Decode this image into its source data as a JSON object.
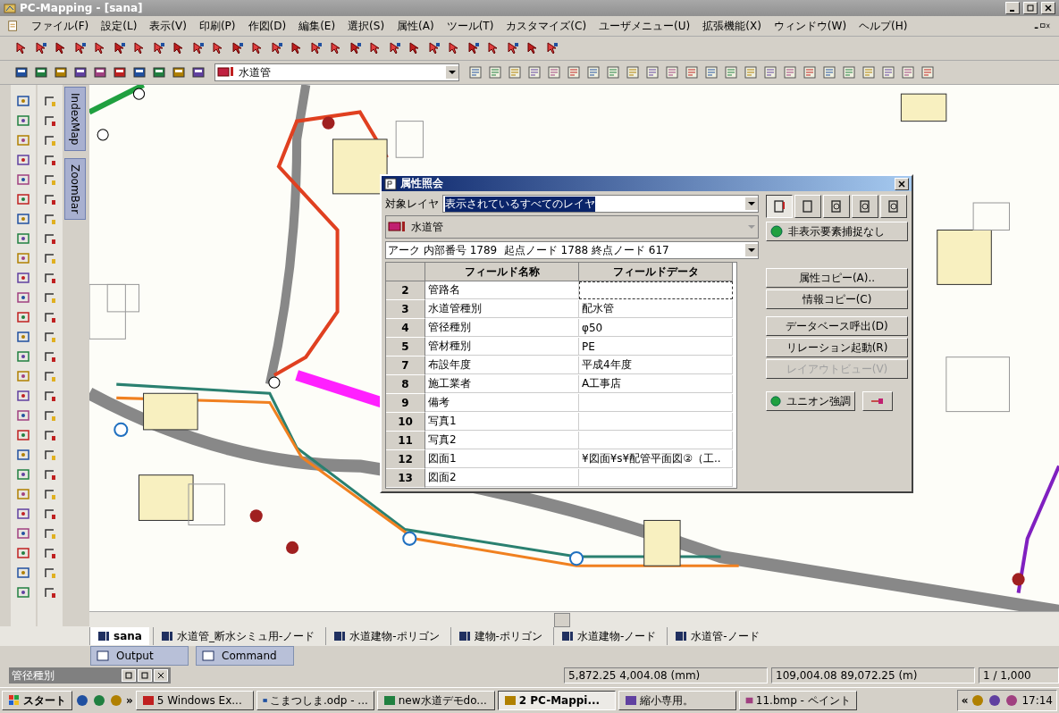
{
  "window": {
    "title": "PC-Mapping - [sana]"
  },
  "menu": [
    "ファイル(F)",
    "設定(L)",
    "表示(V)",
    "印刷(P)",
    "作図(D)",
    "編集(E)",
    "選択(S)",
    "属性(A)",
    "ツール(T)",
    "カスタマイズ(C)",
    "ユーザメニュー(U)",
    "拡張機能(X)",
    "ウィンドウ(W)",
    "ヘルプ(H)"
  ],
  "toolbar": {
    "layer_select": "水道管"
  },
  "side_tabs": [
    "IndexMap",
    "ZoomBar"
  ],
  "dialog": {
    "title": "属性照会",
    "layer_label": "対象レイヤ",
    "layer_value": "表示されているすべてのレイヤ",
    "current_layer": "水道管",
    "arc_info": "アーク 内部番号 1789  起点ノード 1788 終点ノード 617",
    "columns": [
      "フィールド名称",
      "フィールドデータ"
    ],
    "rows": [
      {
        "no": "2",
        "name": "管路名",
        "selected": true
      },
      {
        "no": "3",
        "name": "水道管種別",
        "value": "配水管",
        "selected": false
      },
      {
        "no": "4",
        "name": "管径種別",
        "value": "φ50",
        "selected": false
      },
      {
        "no": "5",
        "name": "管材種別",
        "value": "PE",
        "selected": false
      },
      {
        "no": "7",
        "name": "布設年度",
        "value": "平成4年度",
        "selected": false
      },
      {
        "no": "8",
        "name": "施工業者",
        "value": "A工事店",
        "selected": false
      },
      {
        "no": "9",
        "name": "備考",
        "selected": false
      },
      {
        "no": "10",
        "name": "写真1",
        "selected": false
      },
      {
        "no": "11",
        "name": "写真2",
        "selected": false
      },
      {
        "no": "12",
        "name": "図面1",
        "value": "¥図面¥s¥配管平面図②（工..",
        "selected": false
      },
      {
        "no": "13",
        "name": "図面2",
        "selected": false
      }
    ],
    "hidden_capture": "非表示要素捕捉なし",
    "buttons": [
      {
        "label": "属性コピー(A)..",
        "disabled": false
      },
      {
        "label": "情報コピー(C)",
        "disabled": false
      },
      {
        "label": "データベース呼出(D)",
        "disabled": false
      },
      {
        "label": "リレーション起動(R)",
        "disabled": false
      },
      {
        "label": "レイアウトビュー(V)",
        "disabled": true
      }
    ],
    "union": "ユニオン強調"
  },
  "layer_tabs": [
    {
      "label": "sana",
      "selected": true
    },
    {
      "label": "水道管_断水シミュ用-ノード",
      "selected": false
    },
    {
      "label": "水道建物-ポリゴン",
      "selected": false
    },
    {
      "label": "建物-ポリゴン",
      "selected": false
    },
    {
      "label": "水道建物-ノード",
      "selected": false
    },
    {
      "label": "水道管-ノード",
      "selected": false
    }
  ],
  "output_tabs": [
    "Output",
    "Command"
  ],
  "panel": {
    "title": "管径種別"
  },
  "status_bar": {
    "coords_mm": "5,872.25 4,004.08 (mm)",
    "coords_m": "109,004.08 89,072.25 (m)",
    "scale": "1 / 1,000"
  },
  "taskbar": {
    "start": "スタート",
    "more": "»",
    "items": [
      {
        "label": "5 Windows Ex...",
        "selected": false
      },
      {
        "label": "こまつしま.odp - ...",
        "selected": false
      },
      {
        "label": "new水道デモdo...",
        "selected": false
      },
      {
        "label": "2 PC-Mappi...",
        "selected": true
      },
      {
        "label": "縮小専用。",
        "selected": false
      },
      {
        "label": "11.bmp - ペイント",
        "selected": false
      }
    ],
    "tray_more": "«",
    "clock": "17:14"
  }
}
